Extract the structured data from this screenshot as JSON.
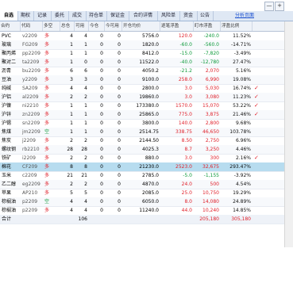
{
  "tabs": [
    "自选",
    "期权",
    "记录",
    "委托",
    "成交",
    "持仓单",
    "保证金",
    "合约详情",
    "风险单",
    "资金",
    "公告"
  ],
  "tab_link": "分析页面",
  "top_buttons": [
    "—",
    "+"
  ],
  "columns": [
    "合约",
    "代码",
    "多空",
    "总仓",
    "可用",
    "今仓",
    "今可用",
    "开仓均价",
    "逐笔浮盈",
    "盯市浮盈",
    "浮盈比例"
  ],
  "rows": [
    {
      "name": "PVC",
      "code": "v2209",
      "dir": "多",
      "dir_color": "red",
      "total": "4",
      "avail": "4",
      "today": "0",
      "today_avail": "0",
      "avg": "5756.0",
      "pnl1": "120.0",
      "pnl1_color": "red",
      "pnl2": "-240.0",
      "pnl2_color": "grn",
      "ratio": "11.52%",
      "ratio_color": "blk",
      "check": false
    },
    {
      "name": "玻璃",
      "code": "FG209",
      "dir": "多",
      "dir_color": "red",
      "total": "1",
      "avail": "1",
      "today": "0",
      "today_avail": "0",
      "avg": "1820.0",
      "pnl1": "-60.0",
      "pnl1_color": "grn",
      "pnl2": "-560.0",
      "pnl2_color": "grn",
      "ratio": "-14.71%",
      "ratio_color": "blk",
      "check": false
    },
    {
      "name": "聚丙烯",
      "code": "pp2209",
      "dir": "多",
      "dir_color": "red",
      "total": "1",
      "avail": "1",
      "today": "0",
      "today_avail": "0",
      "avg": "8412.0",
      "pnl1": "-15.0",
      "pnl1_color": "grn",
      "pnl2": "-7,820",
      "pnl2_color": "grn",
      "ratio": "-3.49%",
      "ratio_color": "blk",
      "check": false
    },
    {
      "name": "聚对二",
      "code": "ta2209",
      "dir": "多",
      "dir_color": "red",
      "total": "1",
      "avail": "0",
      "today": "0",
      "today_avail": "0",
      "avg": "11522.0",
      "pnl1": "-40.0",
      "pnl1_color": "grn",
      "pnl2": "-12,780",
      "pnl2_color": "grn",
      "ratio": "27.47%",
      "ratio_color": "blk",
      "check": false
    },
    {
      "name": "沥青",
      "code": "bu2209",
      "dir": "多",
      "dir_color": "red",
      "total": "6",
      "avail": "6",
      "today": "0",
      "today_avail": "0",
      "avg": "4050.2",
      "pnl1": "-21.2",
      "pnl1_color": "grn",
      "pnl2": "2,070",
      "pnl2_color": "red",
      "ratio": "5.16%",
      "ratio_color": "blk",
      "check": false
    },
    {
      "name": "豆油",
      "code": "y2209",
      "dir": "多",
      "dir_color": "red",
      "total": "3",
      "avail": "3",
      "today": "0",
      "today_avail": "0",
      "avg": "9100.0",
      "pnl1": "258.0",
      "pnl1_color": "red",
      "pnl2": "6,990",
      "pnl2_color": "red",
      "ratio": "19.08%",
      "ratio_color": "blk",
      "check": false
    },
    {
      "name": "纯碱",
      "code": "SA209",
      "dir": "多",
      "dir_color": "red",
      "total": "4",
      "avail": "4",
      "today": "0",
      "today_avail": "0",
      "avg": "2800.0",
      "pnl1": "3.0",
      "pnl1_color": "red",
      "pnl2": "5,030",
      "pnl2_color": "red",
      "ratio": "16.74%",
      "ratio_color": "blk",
      "check": true
    },
    {
      "name": "沪铝",
      "code": "al2209",
      "dir": "多",
      "dir_color": "red",
      "total": "2",
      "avail": "2",
      "today": "0",
      "today_avail": "0",
      "avg": "19860.0",
      "pnl1": "3.0",
      "pnl1_color": "red",
      "pnl2": "3,080",
      "pnl2_color": "red",
      "ratio": "11.23%",
      "ratio_color": "blk",
      "check": true
    },
    {
      "name": "沪镍",
      "code": "ni2210",
      "dir": "多",
      "dir_color": "red",
      "total": "1",
      "avail": "1",
      "today": "0",
      "today_avail": "0",
      "avg": "173380.0",
      "pnl1": "1570.0",
      "pnl1_color": "red",
      "pnl2": "15,070",
      "pnl2_color": "red",
      "ratio": "53.22%",
      "ratio_color": "blk",
      "check": true
    },
    {
      "name": "沪锌",
      "code": "zn2209",
      "dir": "多",
      "dir_color": "red",
      "total": "1",
      "avail": "1",
      "today": "0",
      "today_avail": "0",
      "avg": "25865.0",
      "pnl1": "775.0",
      "pnl1_color": "red",
      "pnl2": "3,875",
      "pnl2_color": "red",
      "ratio": "21.46%",
      "ratio_color": "blk",
      "check": true
    },
    {
      "name": "沪锡",
      "code": "sn2209",
      "dir": "多",
      "dir_color": "red",
      "total": "1",
      "avail": "1",
      "today": "0",
      "today_avail": "0",
      "avg": "3800.0",
      "pnl1": "140.0",
      "pnl1_color": "red",
      "pnl2": "2,800",
      "pnl2_color": "red",
      "ratio": "9.68%",
      "ratio_color": "blk",
      "check": false
    },
    {
      "name": "焦煤",
      "code": "jm2209",
      "dir": "空",
      "dir_color": "grn",
      "total": "1",
      "avail": "1",
      "today": "0",
      "today_avail": "0",
      "avg": "2514.75",
      "pnl1": "338.75",
      "pnl1_color": "red",
      "pnl2": "46,650",
      "pnl2_color": "red",
      "ratio": "103.78%",
      "ratio_color": "blk",
      "check": false
    },
    {
      "name": "焦炭",
      "code": "j2209",
      "dir": "多",
      "dir_color": "red",
      "total": "2",
      "avail": "2",
      "today": "0",
      "today_avail": "0",
      "avg": "2144.50",
      "pnl1": "8.50",
      "pnl1_color": "red",
      "pnl2": "2,750",
      "pnl2_color": "red",
      "ratio": "6.96%",
      "ratio_color": "blk",
      "check": false
    },
    {
      "name": "螺纹钢",
      "code": "rb2210",
      "dir": "多",
      "dir_color": "red",
      "total": "28",
      "avail": "28",
      "today": "0",
      "today_avail": "0",
      "avg": "4025.3",
      "pnl1": "8.7",
      "pnl1_color": "red",
      "pnl2": "3,250",
      "pnl2_color": "red",
      "ratio": "4.46%",
      "ratio_color": "blk",
      "check": false
    },
    {
      "name": "铁矿",
      "code": "i2209",
      "dir": "多",
      "dir_color": "red",
      "total": "2",
      "avail": "2",
      "today": "0",
      "today_avail": "0",
      "avg": "880.0",
      "pnl1": "3.0",
      "pnl1_color": "red",
      "pnl2": "300",
      "pnl2_color": "red",
      "ratio": "2.16%",
      "ratio_color": "blk",
      "check": true
    },
    {
      "name": "棉花",
      "code": "CF209",
      "dir": "多",
      "dir_color": "red",
      "total": "8",
      "avail": "8",
      "today": "0",
      "today_avail": "0",
      "avg": "21230.0",
      "pnl1": "2523.0",
      "pnl1_color": "red",
      "pnl2": "32,675",
      "pnl2_color": "red",
      "ratio": "293.47%",
      "ratio_color": "blk",
      "check": false
    },
    {
      "name": "玉米",
      "code": "c2209",
      "dir": "多",
      "dir_color": "red",
      "total": "21",
      "avail": "21",
      "today": "0",
      "today_avail": "0",
      "avg": "2785.0",
      "pnl1": "-5.0",
      "pnl1_color": "grn",
      "pnl2": "-1,155",
      "pnl2_color": "grn",
      "ratio": "-3.92%",
      "ratio_color": "blk",
      "check": false
    },
    {
      "name": "乙二醇",
      "code": "eg2209",
      "dir": "多",
      "dir_color": "red",
      "total": "2",
      "avail": "2",
      "today": "0",
      "today_avail": "0",
      "avg": "4870.0",
      "pnl1": "24.0",
      "pnl1_color": "red",
      "pnl2": "500",
      "pnl2_color": "red",
      "ratio": "4.54%",
      "ratio_color": "blk",
      "check": false
    },
    {
      "name": "苹果",
      "code": "AP210",
      "dir": "多",
      "dir_color": "red",
      "total": "5",
      "avail": "5",
      "today": "0",
      "today_avail": "0",
      "avg": "2085.0",
      "pnl1": "25.0",
      "pnl1_color": "red",
      "pnl2": "10,750",
      "pnl2_color": "red",
      "ratio": "19.29%",
      "ratio_color": "blk",
      "check": false
    },
    {
      "name": "棕榈油",
      "code": "p2209",
      "dir": "空",
      "dir_color": "grn",
      "total": "4",
      "avail": "4",
      "today": "0",
      "today_avail": "0",
      "avg": "6050.0",
      "pnl1": "8.0",
      "pnl1_color": "red",
      "pnl2": "14,080",
      "pnl2_color": "red",
      "ratio": "24.89%",
      "ratio_color": "blk",
      "check": false
    },
    {
      "name": "棕榈油",
      "code": "p2209",
      "dir": "多",
      "dir_color": "red",
      "total": "4",
      "avail": "4",
      "today": "0",
      "today_avail": "0",
      "avg": "11240.0",
      "pnl1": "44.0",
      "pnl1_color": "red",
      "pnl2": "10,240",
      "pnl2_color": "red",
      "ratio": "14.85%",
      "ratio_color": "blk",
      "check": false
    }
  ],
  "total_row": {
    "name": "合计",
    "avail": "106",
    "pnl1": "",
    "pnl2": "205,180",
    "pnl2_color": "red",
    "ratio": "305,180",
    "ratio_color": "red"
  }
}
